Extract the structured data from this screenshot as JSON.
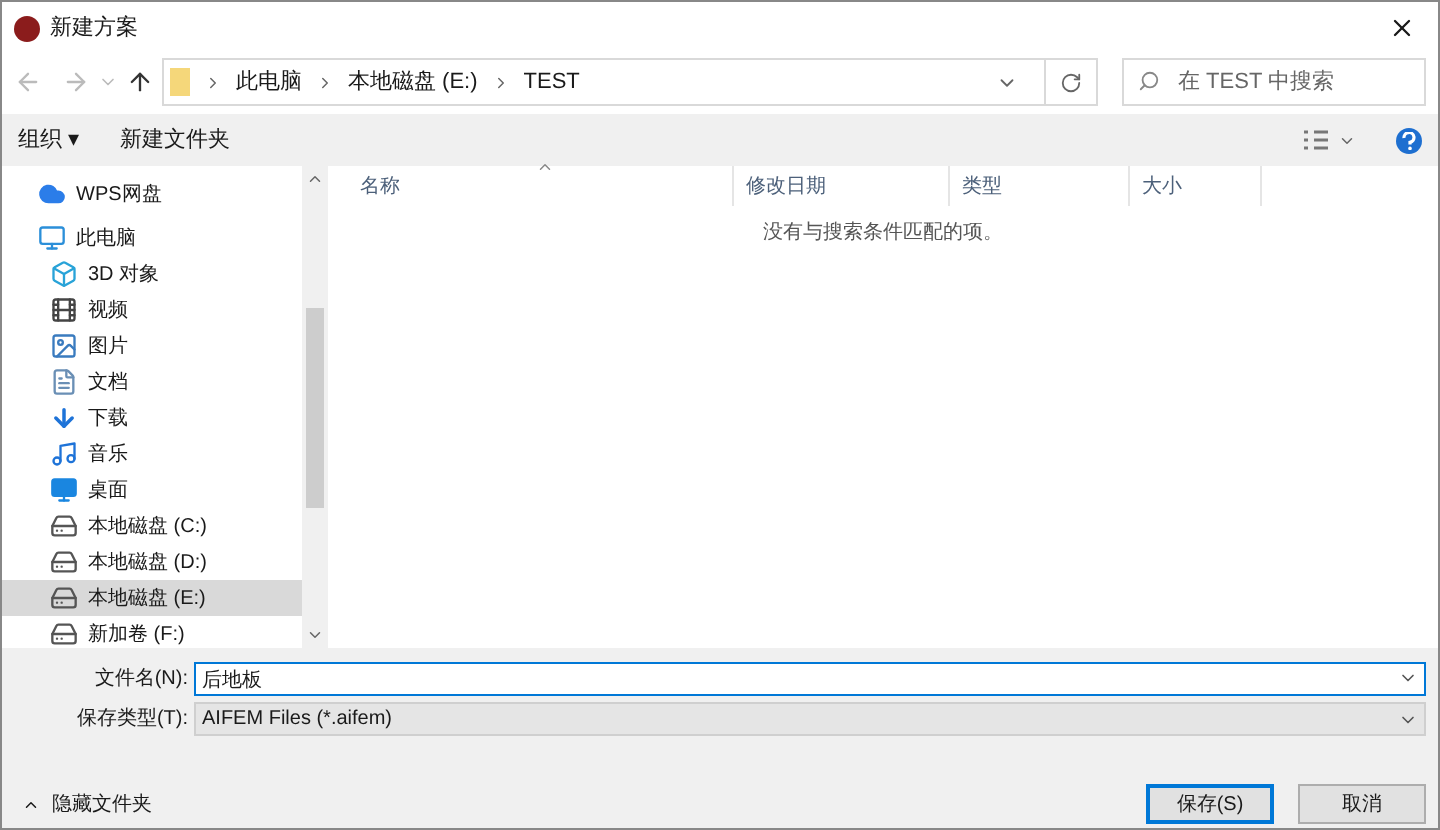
{
  "window": {
    "title": "新建方案"
  },
  "breadcrumb": [
    "此电脑",
    "本地磁盘 (E:)",
    "TEST"
  ],
  "search": {
    "placeholder": "在 TEST 中搜索"
  },
  "toolbar": {
    "organize": "组织 ▾",
    "new_folder": "新建文件夹"
  },
  "sidebar": {
    "items": [
      {
        "label": "WPS网盘",
        "kind": "cloud",
        "selected": false
      },
      {
        "label": "此电脑",
        "kind": "pc",
        "selected": false,
        "children": [
          {
            "label": "3D 对象",
            "kind": "cube",
            "selected": false
          },
          {
            "label": "视频",
            "kind": "video",
            "selected": false
          },
          {
            "label": "图片",
            "kind": "image",
            "selected": false
          },
          {
            "label": "文档",
            "kind": "doc",
            "selected": false
          },
          {
            "label": "下载",
            "kind": "download",
            "selected": false
          },
          {
            "label": "音乐",
            "kind": "music",
            "selected": false
          },
          {
            "label": "桌面",
            "kind": "desktop",
            "selected": false
          },
          {
            "label": "本地磁盘 (C:)",
            "kind": "drive",
            "selected": false
          },
          {
            "label": "本地磁盘 (D:)",
            "kind": "drive",
            "selected": false
          },
          {
            "label": "本地磁盘 (E:)",
            "kind": "drive",
            "selected": true
          },
          {
            "label": "新加卷 (F:)",
            "kind": "drive",
            "selected": false
          }
        ]
      }
    ]
  },
  "table": {
    "columns": [
      "名称",
      "修改日期",
      "类型",
      "大小"
    ],
    "empty_message": "没有与搜索条件匹配的项。"
  },
  "filename": {
    "label": "文件名(N):",
    "value": "后地板"
  },
  "filetype": {
    "label": "保存类型(T):",
    "value": "AIFEM Files (*.aifem)"
  },
  "hide_folders": "隐藏文件夹",
  "buttons": [
    "保存(S)",
    "取消"
  ]
}
